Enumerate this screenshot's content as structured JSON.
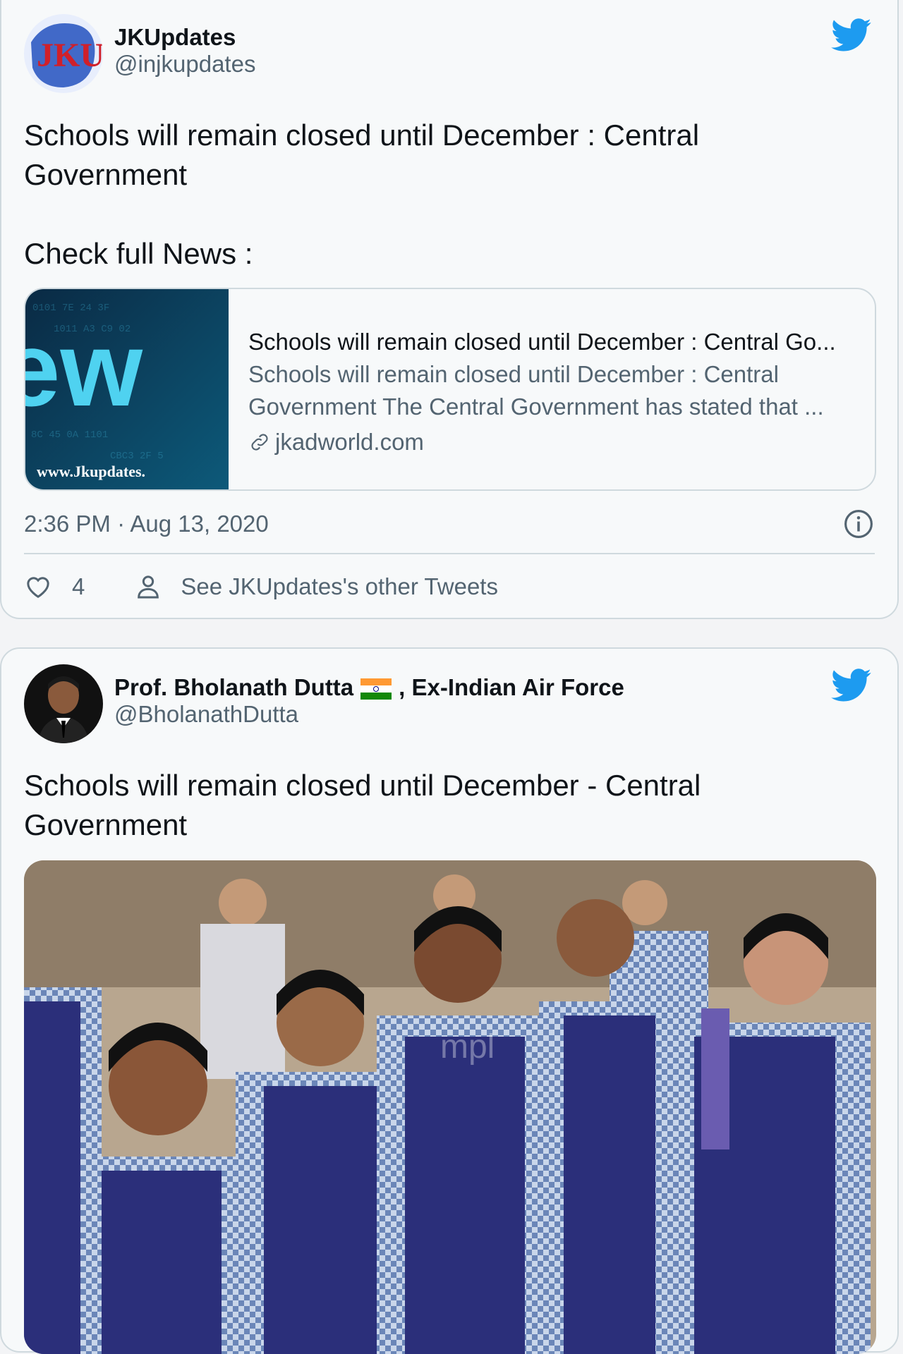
{
  "tweets": [
    {
      "author": {
        "name": "JKUpdates",
        "handle": "@injkupdates",
        "avatar_text": "JKU"
      },
      "text": "Schools will remain closed until December : Central Government\n\nCheck full News :",
      "card": {
        "thumb_text": "ew",
        "thumb_url_text": "www.Jkupdates.",
        "title": "Schools will remain closed until December : Central Go...",
        "description": "Schools will remain closed until December : Central Government The Central Government has stated that ...",
        "domain": "jkadworld.com"
      },
      "timestamp": "2:36 PM · Aug 13, 2020",
      "likes": "4",
      "see_other": "See JKUpdates's other Tweets"
    },
    {
      "author": {
        "name_before_flag": "Prof. Bholanath Dutta",
        "name_after_flag": ", Ex-Indian Air Force",
        "handle": "@BholanathDutta"
      },
      "text": "Schools will remain closed until December - Central Government",
      "photo": {
        "watermark": "mpl"
      }
    }
  ],
  "colors": {
    "twitter_blue": "#1d9bf0",
    "text_secondary": "#536471",
    "border": "#cfd9de"
  },
  "icons": [
    "twitter-bird-icon",
    "info-icon",
    "heart-icon",
    "person-icon",
    "link-icon",
    "india-flag-icon"
  ]
}
